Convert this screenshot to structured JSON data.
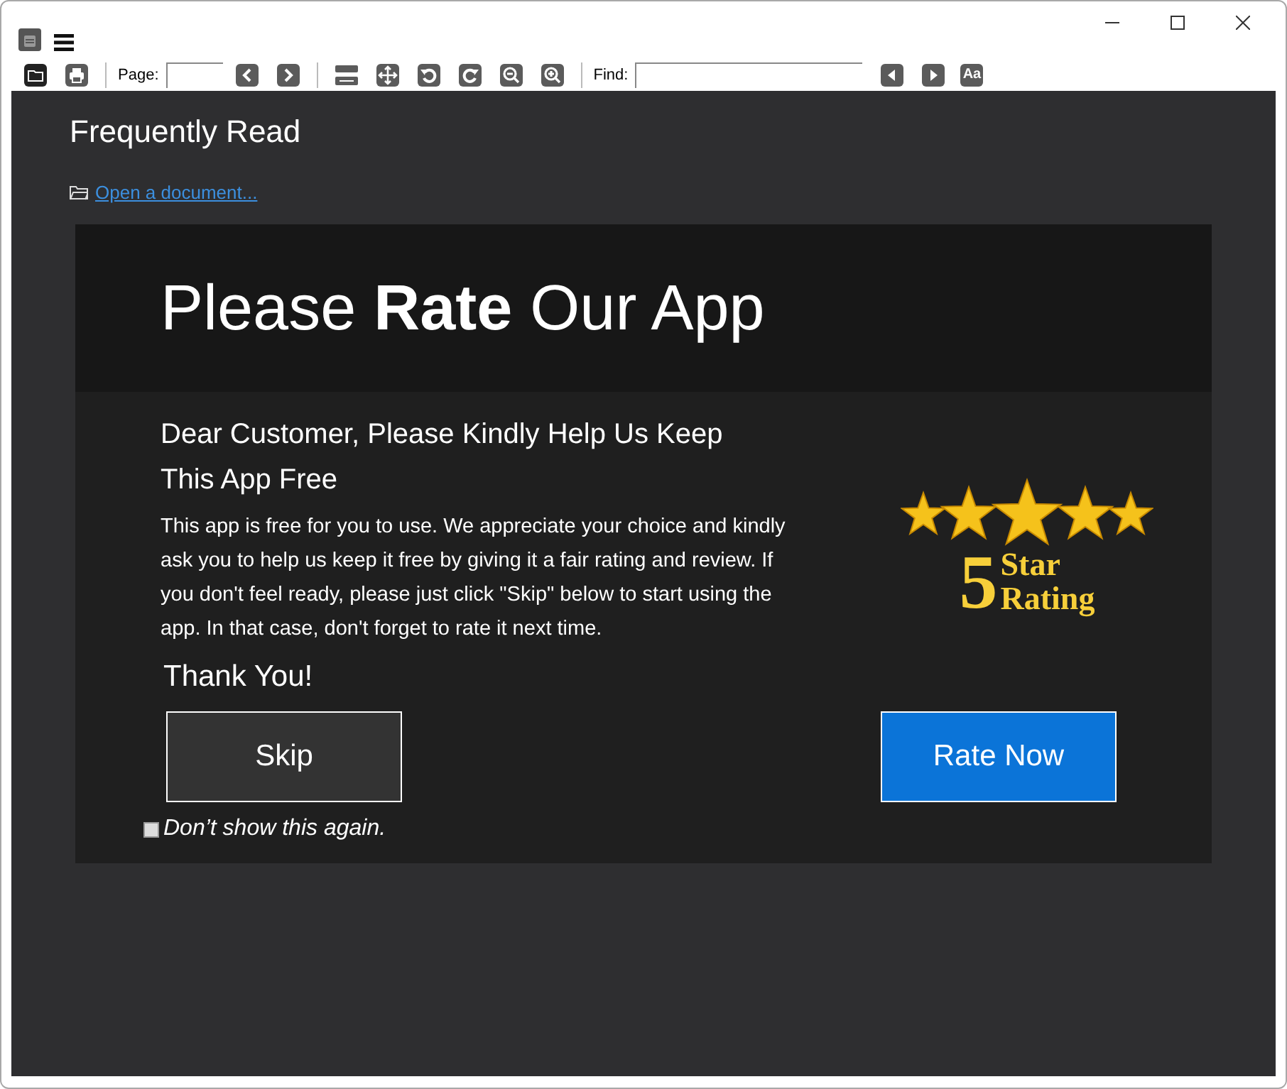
{
  "toolbar": {
    "page_label": "Page:",
    "find_label": "Find:",
    "match_case": "Aa"
  },
  "home": {
    "title": "Frequently Read",
    "open_link": "Open a document..."
  },
  "dialog": {
    "title": "Please **Rate** Our App",
    "heading": "Dear Customer, Please Kindly Help Us Keep This App Free",
    "body": "This app is free for you to use. We appreciate your choice and kindly ask you to help us keep it free by giving it a fair rating and review. If you don't feel ready, please just click \"Skip\" below to start using the app. In that case, don't forget to rate it next time.",
    "thanks": "Thank You!",
    "badge": {
      "number": "5",
      "line1": "Star",
      "line2": "Rating"
    },
    "buttons": [
      {
        "label": "Skip",
        "kind": "secondary"
      },
      {
        "label": "Rate Now",
        "kind": "primary"
      }
    ],
    "dont_show": {
      "label": "Don’t show this again.",
      "checked": false
    }
  }
}
